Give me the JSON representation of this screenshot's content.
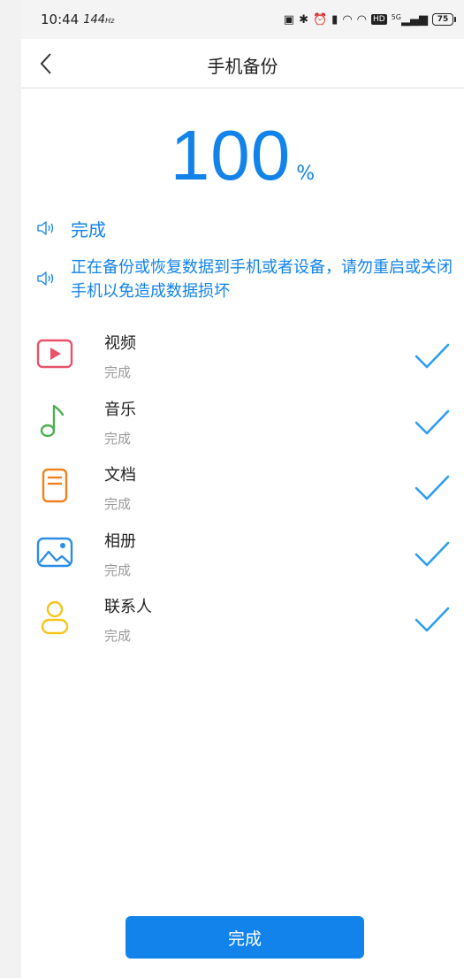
{
  "status_bar": {
    "time": "10:44",
    "refresh": "144",
    "refresh_unit": "Hz",
    "network": "5G",
    "battery": "75"
  },
  "header": {
    "title": "手机备份"
  },
  "progress": {
    "value": "100",
    "unit": "%"
  },
  "notices": [
    {
      "text": "完成"
    },
    {
      "text": "正在备份或恢复数据到手机或者设备，请勿重启或关闭手机以免造成数据损坏"
    }
  ],
  "items": [
    {
      "name": "视频",
      "status": "完成",
      "icon": "video-icon",
      "color": "#e8536b"
    },
    {
      "name": "音乐",
      "status": "完成",
      "icon": "music-icon",
      "color": "#4caf50"
    },
    {
      "name": "文档",
      "status": "完成",
      "icon": "document-icon",
      "color": "#f0811e"
    },
    {
      "name": "相册",
      "status": "完成",
      "icon": "album-icon",
      "color": "#2d8de6"
    },
    {
      "name": "联系人",
      "status": "完成",
      "icon": "contact-icon",
      "color": "#f5c518"
    }
  ],
  "button": {
    "label": "完成"
  },
  "colors": {
    "accent": "#1283ea",
    "check": "#2c9ef0"
  }
}
